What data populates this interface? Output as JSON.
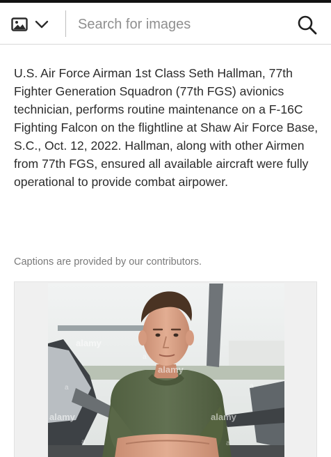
{
  "search": {
    "placeholder": "Search for images",
    "type_icon": "image-icon",
    "dropdown_icon": "chevron-down-icon",
    "submit_icon": "search-icon"
  },
  "caption": {
    "text": "U.S. Air Force Airman 1st Class Seth Hallman, 77th Fighter Generation Squadron (77th FGS) avionics technician, performs routine maintenance on a F-16C Fighting Falcon on the flightline at Shaw Air Force Base, S.C., Oct. 12, 2022. Hallman, along with other Airmen from 77th FGS, ensured all available aircraft were fully operational to provide combat airpower.",
    "contributor_note": "Captions are provided by our contributors."
  },
  "photo": {
    "watermark": "alamy"
  },
  "colors": {
    "text": "#2b2b2b",
    "muted": "#7a7a7a",
    "placeholder": "#8f8f8f",
    "shirt": "#5b6a48",
    "sky": "#e9ecec"
  }
}
